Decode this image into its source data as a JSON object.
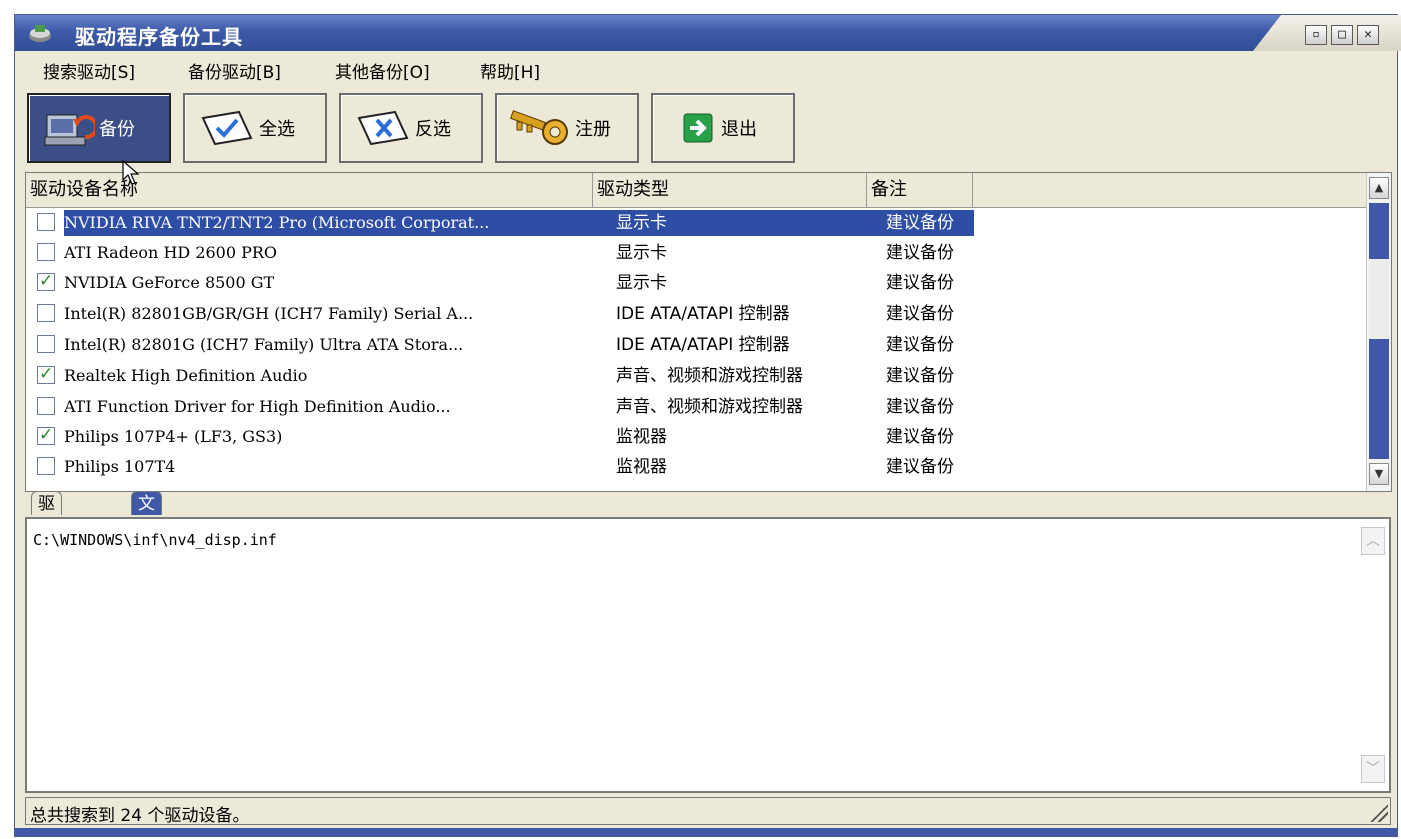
{
  "window": {
    "title": "驱动程序备份工具",
    "controls": [
      "restore",
      "maximize",
      "close"
    ]
  },
  "menu": [
    {
      "label": "搜索驱动[S]"
    },
    {
      "label": "备份驱动[B]"
    },
    {
      "label": "其他备份[O]"
    },
    {
      "label": "帮助[H]"
    }
  ],
  "toolbar": {
    "backup_label": "备份",
    "select_all_label": "全选",
    "invert_label": "反选",
    "register_label": "注册",
    "exit_label": "退出"
  },
  "list": {
    "columns": [
      "驱动设备名称",
      "驱动类型",
      "备注"
    ],
    "rows": [
      {
        "name": "NVIDIA RIVA TNT2/TNT2 Pro (Microsoft Corporat...",
        "type": "显示卡",
        "note": "建议备份",
        "checked": false,
        "selected": true
      },
      {
        "name": "ATI Radeon HD 2600 PRO",
        "type": "显示卡",
        "note": "建议备份",
        "checked": false,
        "selected": false
      },
      {
        "name": "NVIDIA GeForce 8500 GT",
        "type": "显示卡",
        "note": "建议备份",
        "checked": true,
        "selected": false
      },
      {
        "name": "Intel(R) 82801GB/GR/GH (ICH7 Family) Serial A...",
        "type": "IDE ATA/ATAPI 控制器",
        "note": "建议备份",
        "checked": false,
        "selected": false
      },
      {
        "name": "Intel(R) 82801G (ICH7 Family) Ultra ATA Stora...",
        "type": "IDE ATA/ATAPI 控制器",
        "note": "建议备份",
        "checked": false,
        "selected": false
      },
      {
        "name": "Realtek High Definition Audio",
        "type": "声音、视频和游戏控制器",
        "note": "建议备份",
        "checked": true,
        "selected": false
      },
      {
        "name": "ATI Function Driver for High Definition Audio...",
        "type": "声音、视频和游戏控制器",
        "note": "建议备份",
        "checked": false,
        "selected": false
      },
      {
        "name": "Philips 107P4+ (LF3, GS3)",
        "type": "监视器",
        "note": "建议备份",
        "checked": true,
        "selected": false
      },
      {
        "name": "Philips 107T4",
        "type": "监视器",
        "note": "建议备份",
        "checked": false,
        "selected": false
      }
    ]
  },
  "tabs": [
    {
      "label": "驱动摘要",
      "active": false
    },
    {
      "label": "文件列表",
      "active": true
    }
  ],
  "details": {
    "path": "C:\\WINDOWS\\inf\\nv4_disp.inf"
  },
  "status": {
    "text": "总共搜索到 24 个驱动设备。"
  },
  "colors": {
    "title_bar": "#3c5aa8",
    "selection": "#2e4ea6",
    "window_bg": "#ece9d8"
  }
}
